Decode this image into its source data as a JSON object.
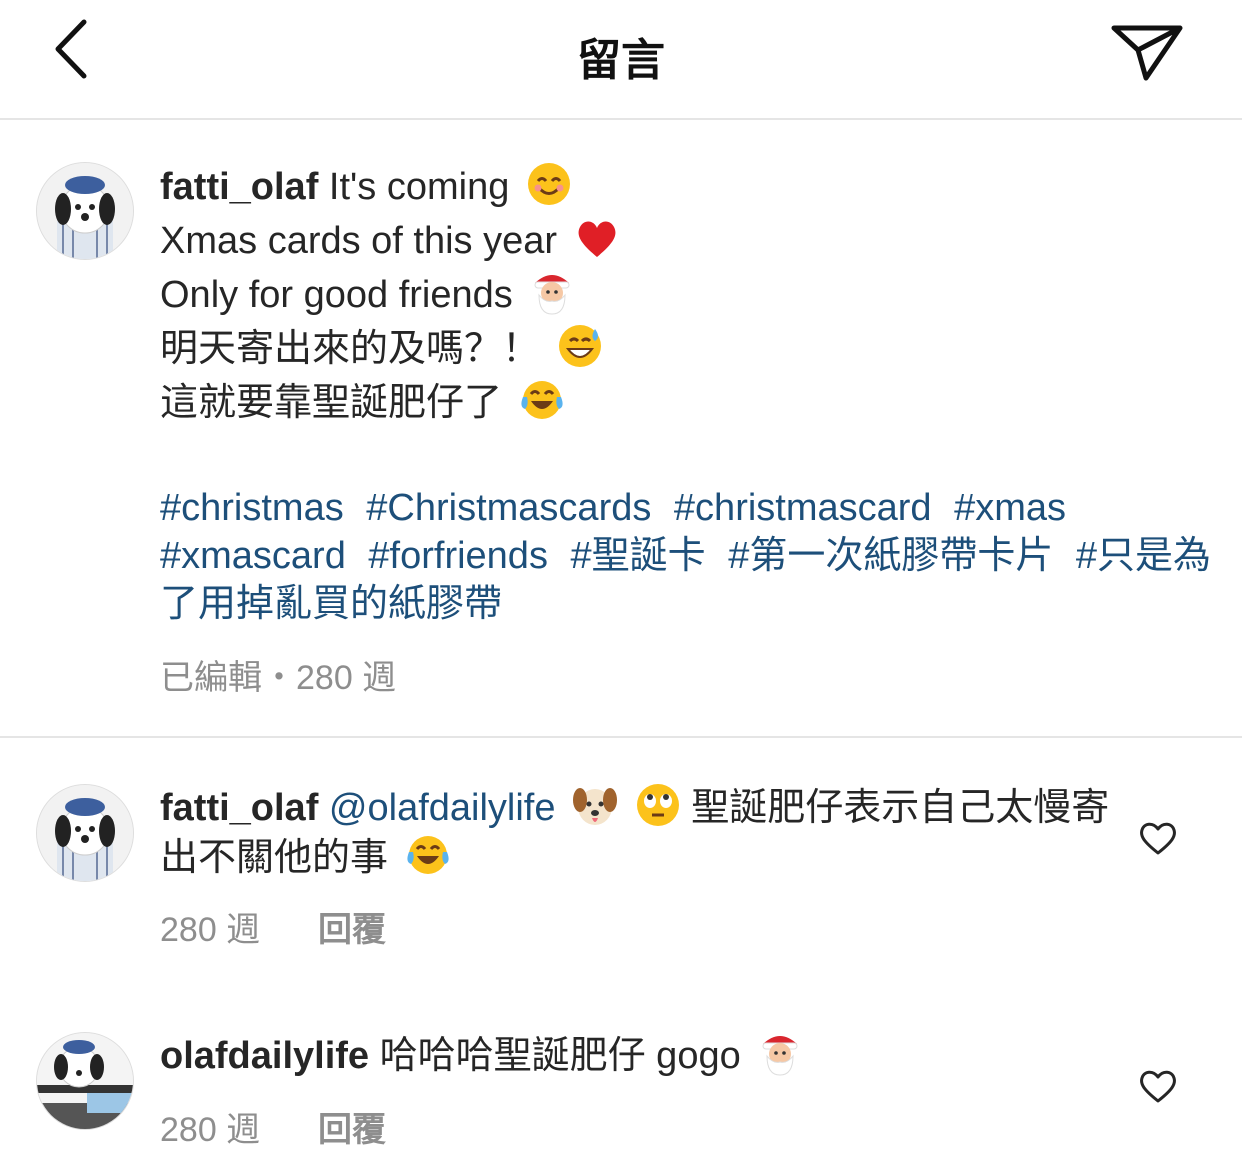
{
  "header": {
    "title": "留言",
    "back_icon": "chevron-left-icon",
    "send_icon": "paper-plane-icon"
  },
  "caption": {
    "username": "fatti_olaf",
    "lines": [
      "It's coming",
      "Xmas cards of this year",
      "Only for good friends",
      "明天寄出來的及嗎？！",
      "這就要靠聖誕肥仔了"
    ],
    "emojis": [
      "smiling-face-emoji",
      "red-heart-emoji",
      "santa-emoji",
      "grinning-sweat-emoji",
      "tears-of-joy-emoji"
    ],
    "hashtags": [
      "#christmas",
      "#Christmascards",
      "#christmascard",
      "#xmas",
      "#xmascard",
      "#forfriends",
      "#聖誕卡",
      "#第一次紙膠帶卡片",
      "#只是為了用掉亂買的紙膠帶"
    ],
    "meta": "已編輯・280 週"
  },
  "comments": [
    {
      "username": "fatti_olaf",
      "mention": "@olafdailylife",
      "text": "聖誕肥仔表示自己太慢寄出不關他的事",
      "emojis": [
        "dog-face-emoji",
        "eye-roll-emoji",
        "tears-of-joy-emoji"
      ],
      "time": "280 週",
      "reply_label": "回覆"
    },
    {
      "username": "olafdailylife",
      "text": "哈哈哈聖誕肥仔 gogo",
      "emojis": [
        "santa-emoji"
      ],
      "time": "280 週",
      "reply_label": "回覆"
    }
  ],
  "colors": {
    "link": "#1d4f7a",
    "meta": "#8e8e8e",
    "text": "#262626"
  }
}
